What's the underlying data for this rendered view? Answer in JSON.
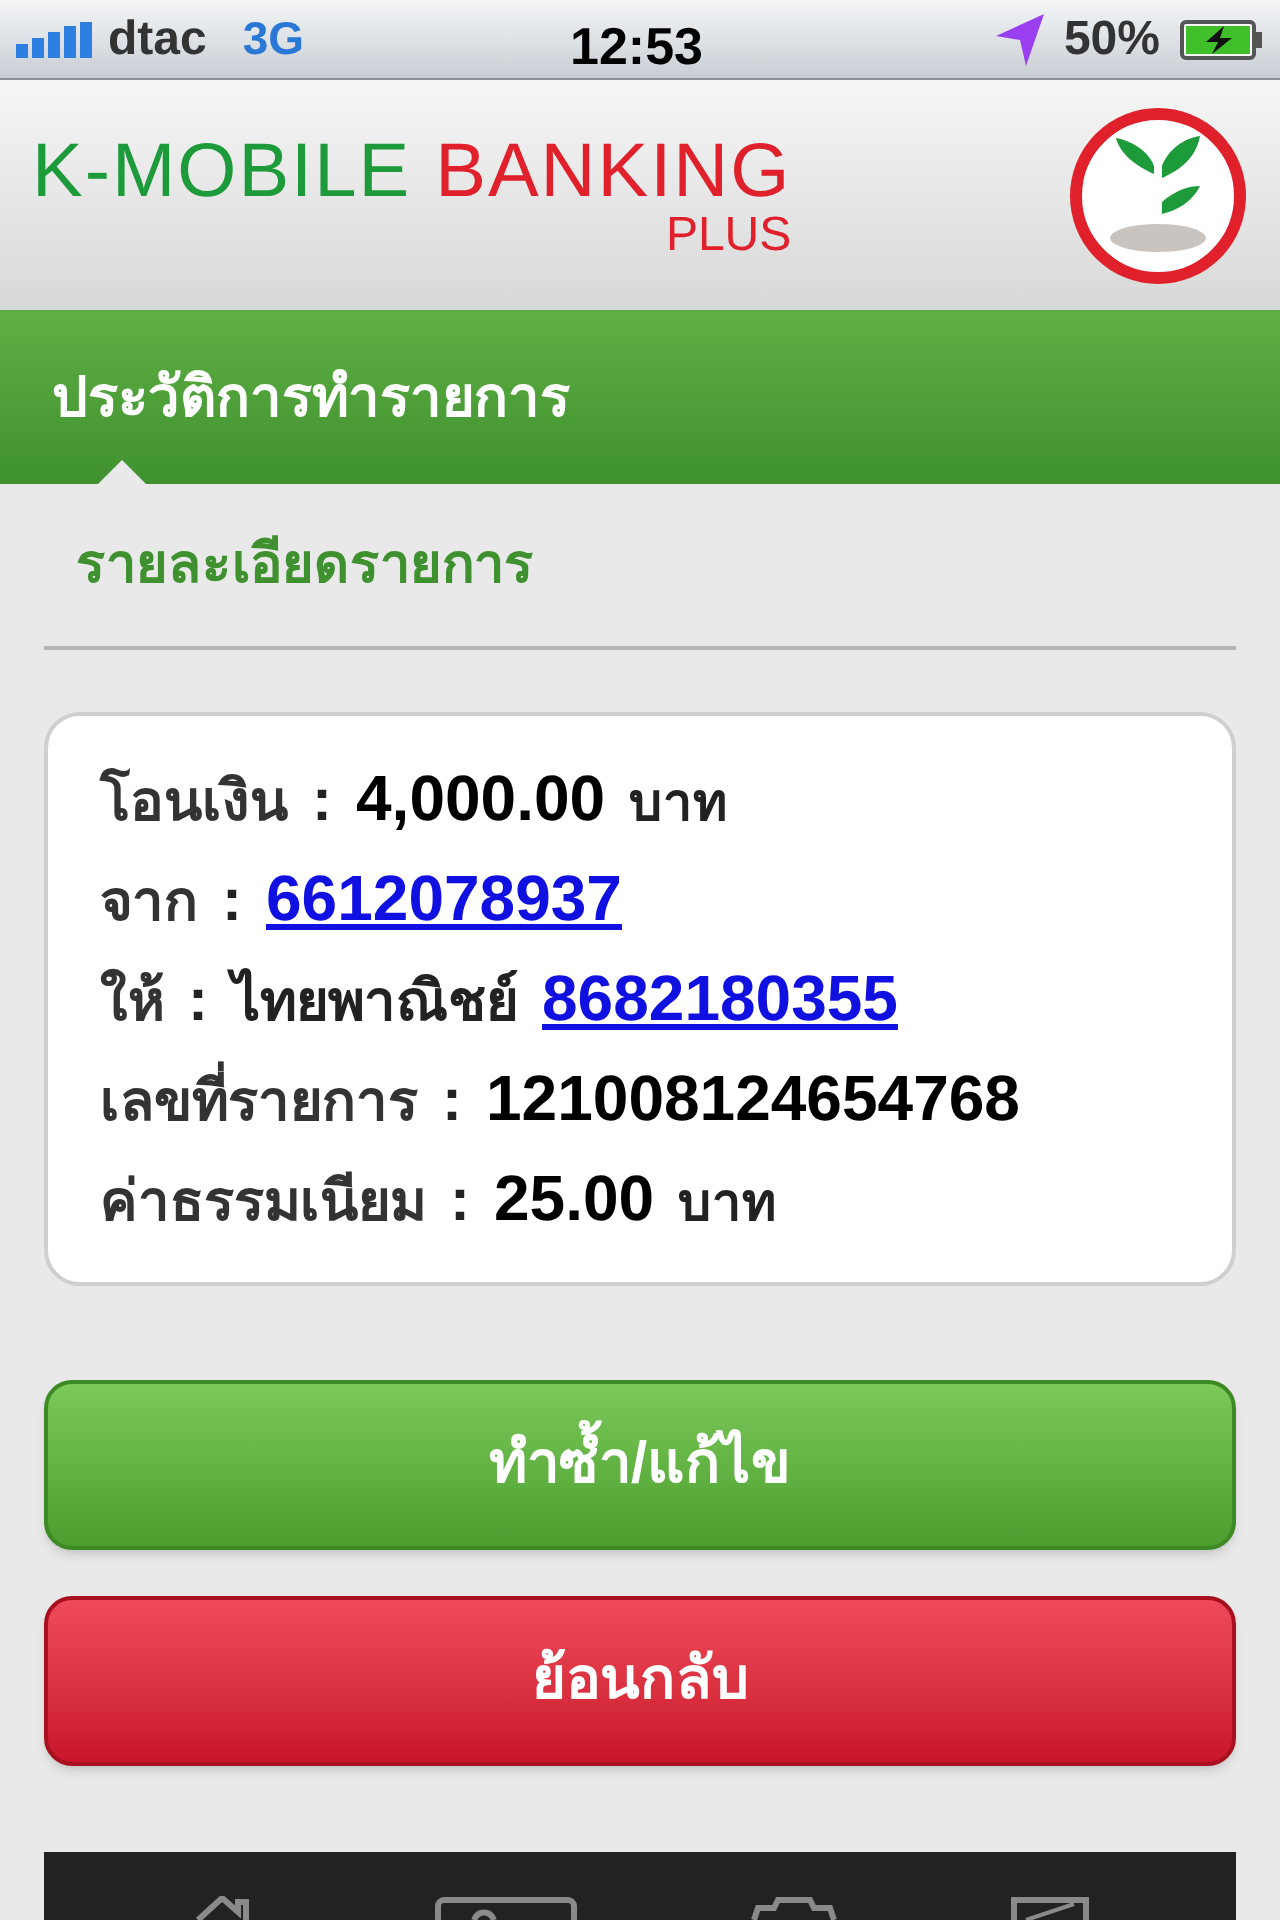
{
  "status_bar": {
    "carrier": "dtac",
    "network": "3G",
    "time": "12:53",
    "battery": "50%"
  },
  "header": {
    "logo_part_1": "K-MOBILE",
    "logo_part_2": "BANKING",
    "logo_part_3": "PLUS"
  },
  "section_title": "ประวัติการทำรายการ",
  "subtitle": "รายละเอียดรายการ",
  "details": [
    {
      "label": "โอนเงิน",
      "parts": [
        {
          "kind": "value",
          "text": "4,000.00"
        },
        {
          "kind": "unit",
          "text": "บาท"
        }
      ]
    },
    {
      "label": "จาก",
      "parts": [
        {
          "kind": "link",
          "text": "6612078937"
        }
      ]
    },
    {
      "label": "ให้",
      "parts": [
        {
          "kind": "bank",
          "text": "ไทยพาณิชย์"
        },
        {
          "kind": "link",
          "text": "8682180355"
        }
      ]
    },
    {
      "label": "เลขที่รายการ",
      "parts": [
        {
          "kind": "value",
          "text": "121008124654768"
        }
      ]
    },
    {
      "label": "ค่าธรรมเนียม",
      "parts": [
        {
          "kind": "value",
          "text": "25.00"
        },
        {
          "kind": "unit",
          "text": "บาท"
        }
      ]
    }
  ],
  "separator": ":",
  "buttons": [
    {
      "kind": "primary",
      "label": "ทำซ้ำ/แก้ไข"
    },
    {
      "kind": "danger",
      "label": "ย้อนกลับ"
    }
  ],
  "tab_bar": [
    {
      "kind": "home"
    },
    {
      "kind": "card"
    },
    {
      "kind": "gear"
    },
    {
      "kind": "box"
    }
  ]
}
